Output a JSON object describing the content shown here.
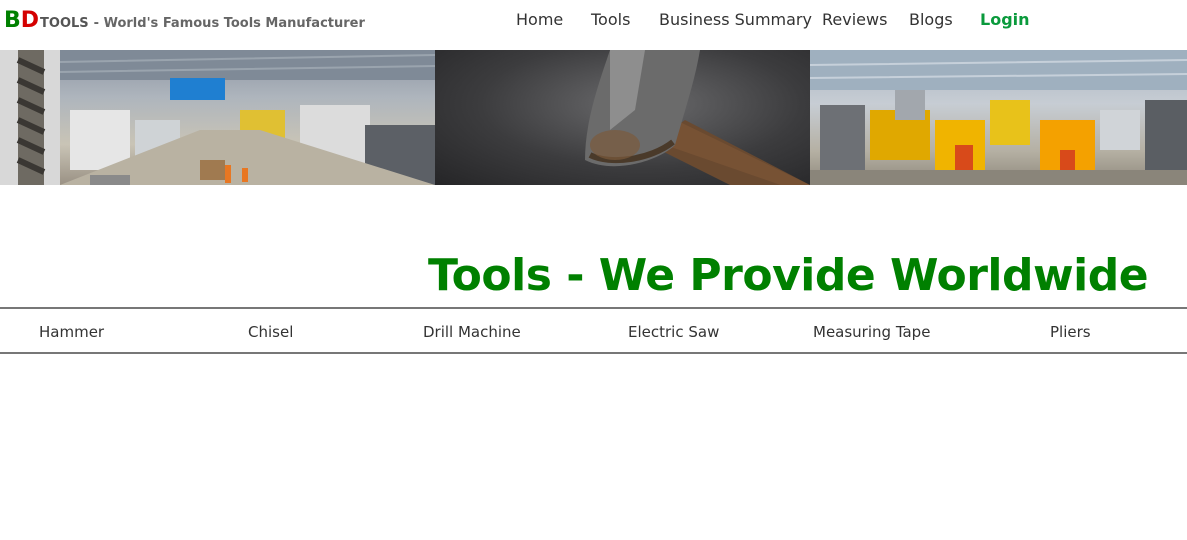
{
  "brand": {
    "letter_b": "B",
    "letter_d": "D",
    "tools": "TOOLS",
    "tagline": "- World's Famous Tools Manufacturer"
  },
  "nav": {
    "home": "Home",
    "tools": "Tools",
    "business_summary": "Business Summary",
    "reviews": "Reviews",
    "blogs": "Blogs",
    "login": "Login"
  },
  "banner": {
    "images": [
      "factory-floor-image",
      "hammer-image",
      "assembly-line-image"
    ]
  },
  "heading": "Tools - We Provide Worldwide",
  "tabs": [
    "Hammer",
    "Chisel",
    "Drill Machine",
    "Electric Saw",
    "Measuring Tape",
    "Pliers"
  ],
  "colors": {
    "brand_green": "#008000",
    "brand_red": "#d40000",
    "login_green": "#0a9a3c",
    "heading_green": "#008000"
  }
}
